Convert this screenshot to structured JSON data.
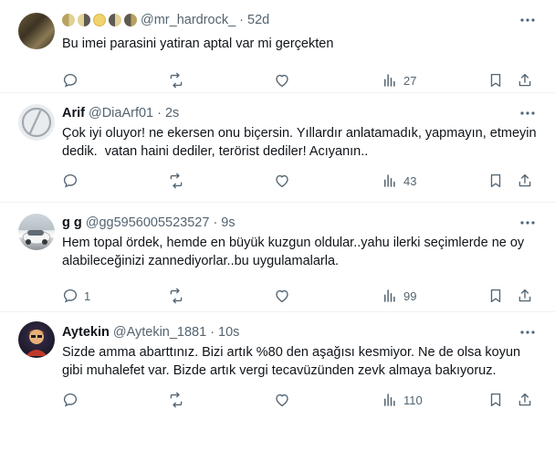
{
  "tweets": [
    {
      "name": "",
      "handle": "@mr_hardrock_",
      "time": "52d",
      "text": "Bu imei parasini yatiran aptal var mi gerçekten",
      "reply_count": "",
      "retweet_count": "",
      "like_count": "",
      "view_count": "27",
      "display_name_emojis": [
        "waning-moon",
        "last-quarter-moon",
        "full-moon",
        "first-quarter-moon",
        "waxing-moon"
      ]
    },
    {
      "name": "Arif",
      "handle": "@DiaArf01",
      "time": "2s",
      "text": "Çok iyi oluyor! ne ekersen onu biçersin. Yıllardır anlatamadık, yapmayın, etmeyin dedik.  vatan haini dediler, terörist dediler! Acıyanın..",
      "reply_count": "",
      "retweet_count": "",
      "like_count": "",
      "view_count": "43"
    },
    {
      "name": "g g",
      "handle": "@gg5956005523527",
      "time": "9s",
      "text": "Hem topal ördek, hemde en büyük kuzgun oldular..yahu ilerki seçimlerde ne oy alabileceğinizi zannediyorlar..bu uygulamalarla.",
      "reply_count": "1",
      "retweet_count": "",
      "like_count": "",
      "view_count": "99"
    },
    {
      "name": "Aytekin",
      "handle": "@Aytekin_1881",
      "time": "10s",
      "text": "Sizde amma abarttınız. Bizi artık %80 den aşağısı kesmiyor. Ne de olsa koyun gibi muhalefet var. Bizde artık vergi tecavüzünden zevk almaya bakıyoruz.",
      "reply_count": "",
      "retweet_count": "",
      "like_count": "",
      "view_count": "110"
    }
  ],
  "separator": "·",
  "colors": {
    "text": "#0f1419",
    "secondary": "#536471",
    "border": "#eff3f4"
  }
}
